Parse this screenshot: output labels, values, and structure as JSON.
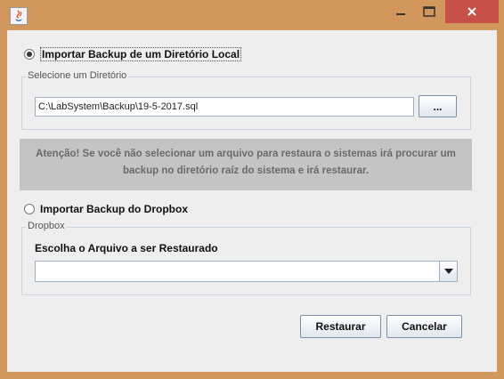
{
  "window": {
    "title": "",
    "controls": {
      "minimize": "minimize-icon",
      "maximize": "maximize-icon",
      "close": "close-icon"
    },
    "colors": {
      "frame": "#d1975c",
      "close": "#c7504b",
      "client": "#eeeeee"
    }
  },
  "local_backup": {
    "option_label": "Importar Backup de um Diretório Local",
    "selected": true,
    "group_title": "Selecione um Diretório",
    "path_value": "C:\\LabSystem\\Backup\\19-5-2017.sql",
    "browse_label": "..."
  },
  "warning": {
    "line1": "Atenção! Se você não selecionar um arquivo para restaura o sistemas irá procurar um",
    "line2": "backup no diretório raíz do sistema e irá restaurar."
  },
  "dropbox_backup": {
    "option_label": "Importar Backup do Dropbox",
    "selected": false,
    "group_title": "Dropbox",
    "choose_label": "Escolha o Arquivo a ser Restaurado",
    "selected_file": ""
  },
  "actions": {
    "restore_label": "Restaurar",
    "cancel_label": "Cancelar"
  }
}
